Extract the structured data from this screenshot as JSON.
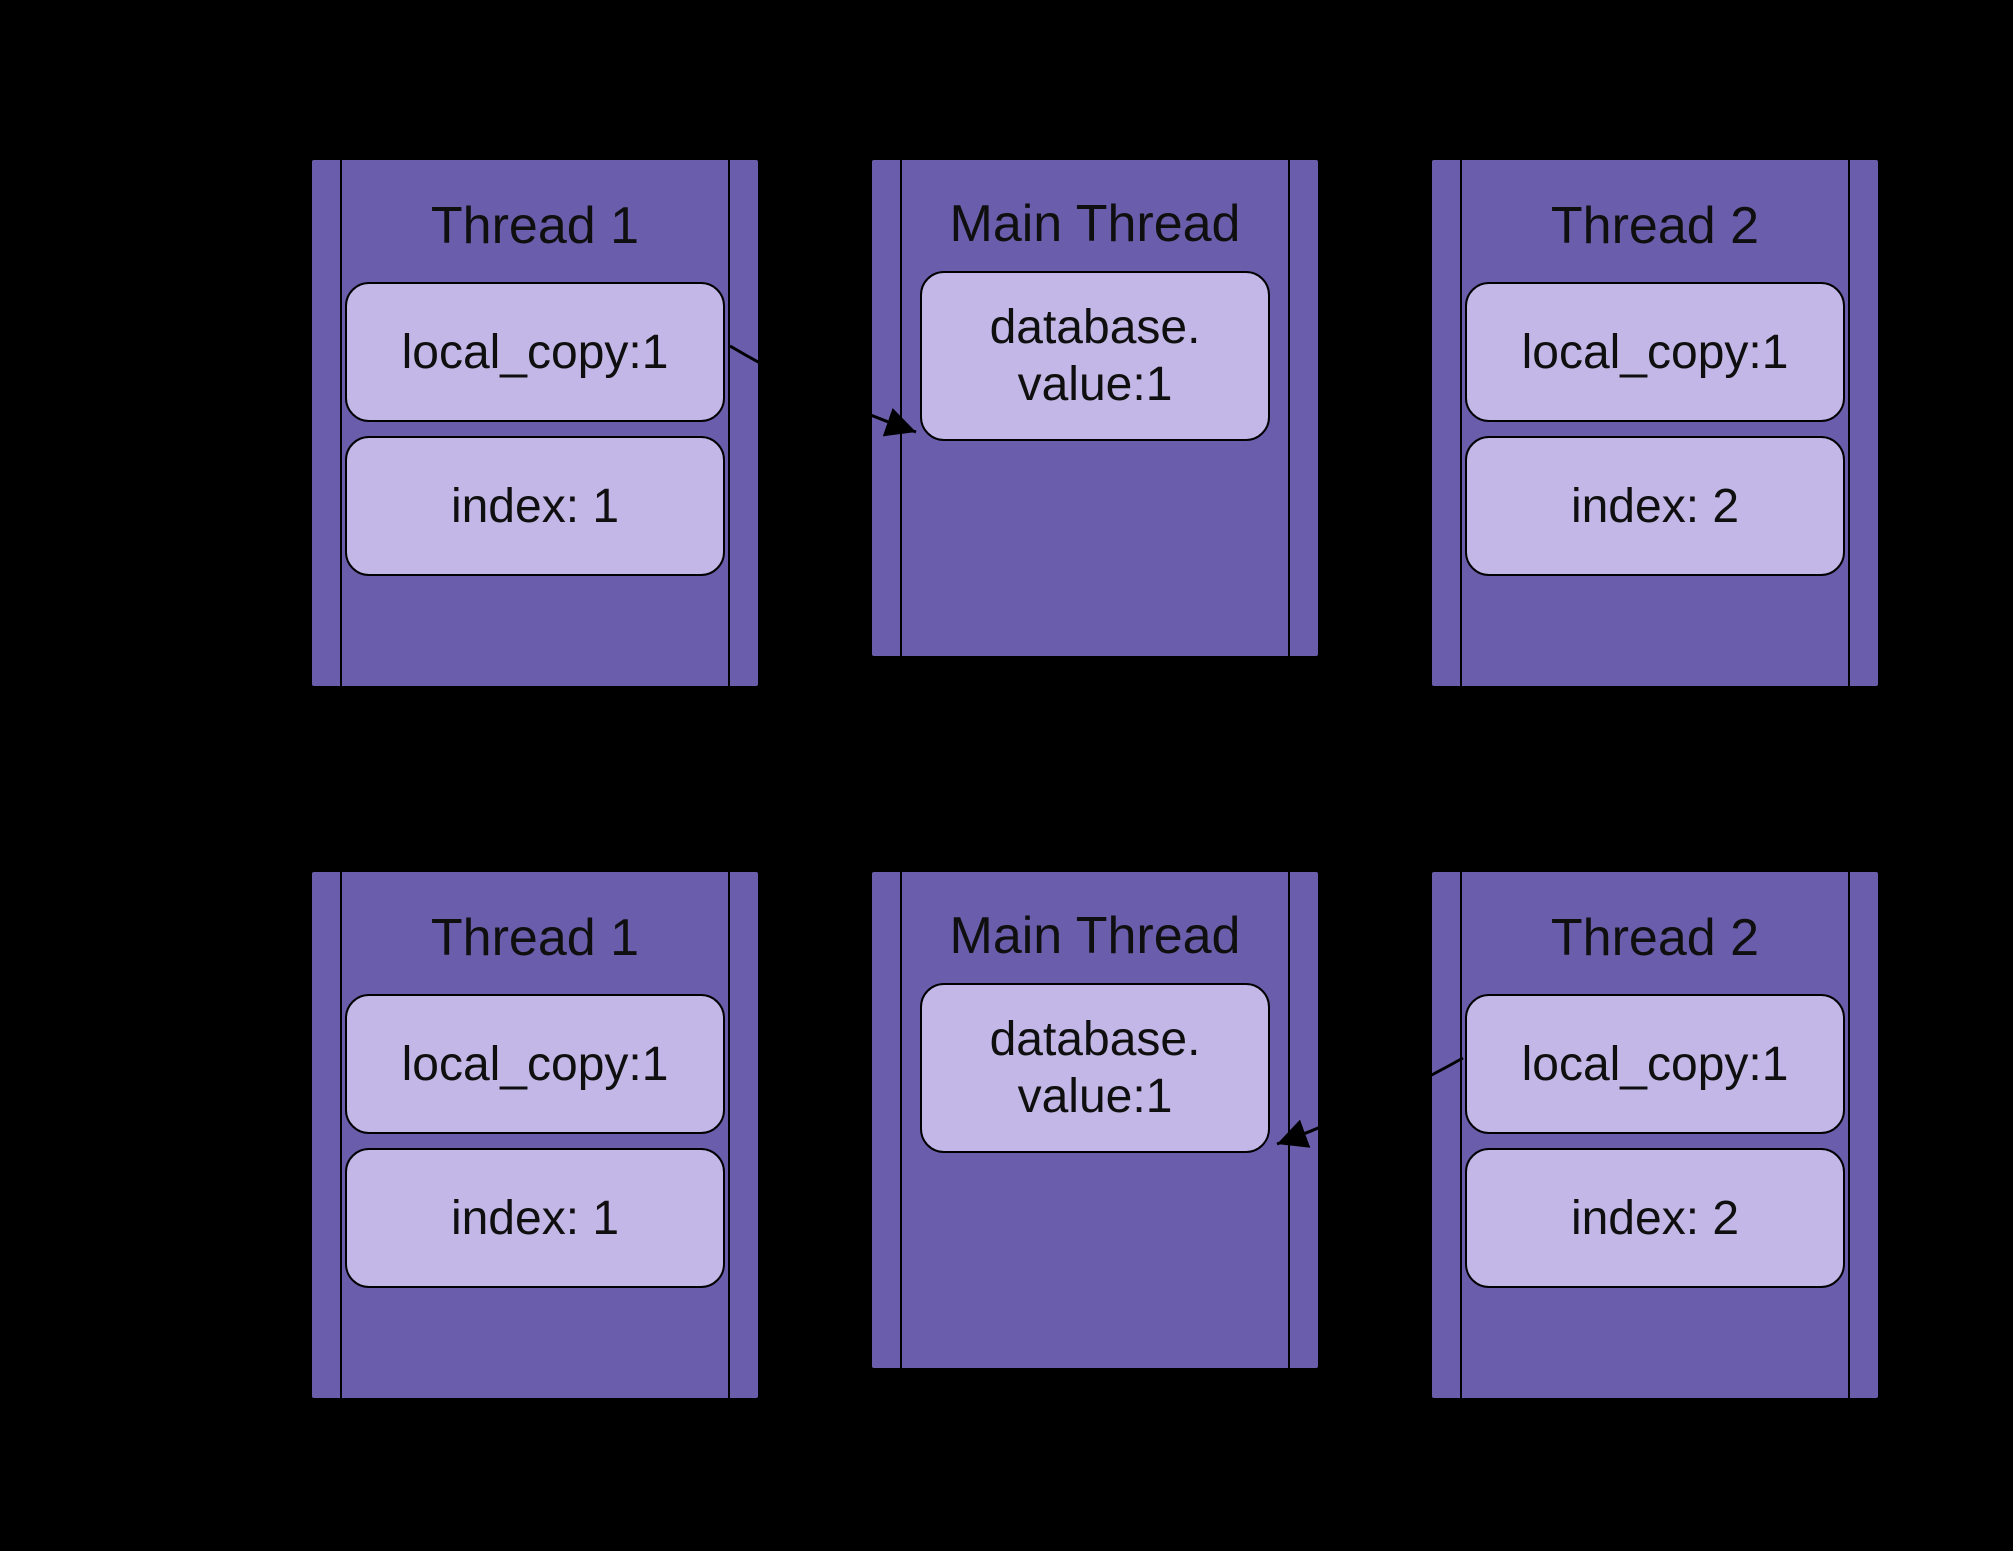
{
  "rows": [
    {
      "thread1": {
        "title": "Thread 1",
        "local_copy": "local_copy:1",
        "index": "index: 1"
      },
      "main": {
        "title": "Main Thread",
        "db": "database.\nvalue:1"
      },
      "thread2": {
        "title": "Thread 2",
        "local_copy": "local_copy:1",
        "index": "index: 2"
      }
    },
    {
      "thread1": {
        "title": "Thread 1",
        "local_copy": "local_copy:1",
        "index": "index: 1"
      },
      "main": {
        "title": "Main Thread",
        "db": "database.\nvalue:1"
      },
      "thread2": {
        "title": "Thread 2",
        "local_copy": "local_copy:1",
        "index": "index: 2"
      }
    }
  ]
}
